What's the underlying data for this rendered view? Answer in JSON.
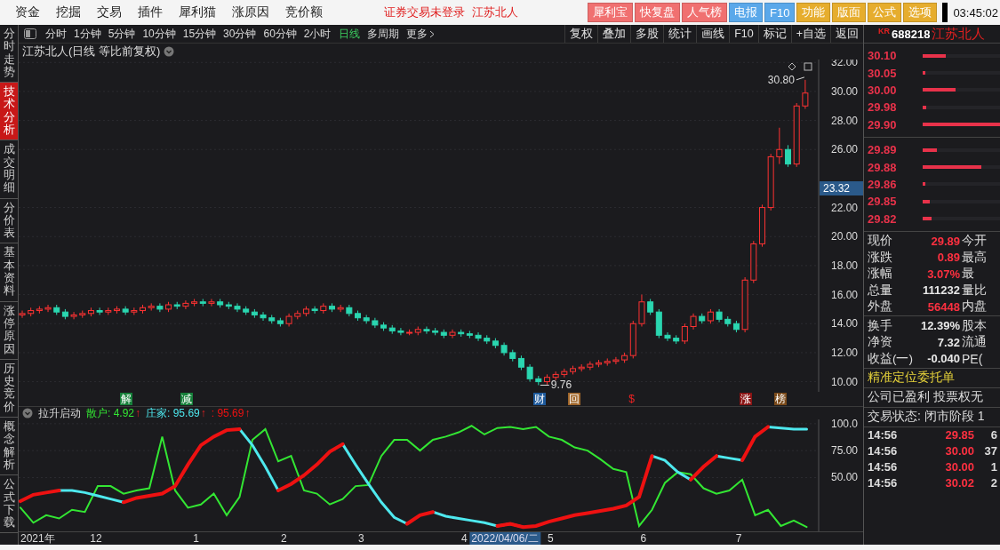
{
  "menu_bar": {
    "items": [
      "资金",
      "挖掘",
      "交易",
      "插件",
      "犀利猫",
      "涨原因",
      "竞价额"
    ],
    "login_status": "证券交易未登录",
    "stock_name": "江苏北人",
    "buttons": [
      {
        "label": "犀利宝",
        "color": "#f07070"
      },
      {
        "label": "快复盘",
        "color": "#f07070"
      },
      {
        "label": "人气榜",
        "color": "#f07070"
      },
      {
        "label": "电报",
        "color": "#5aa8ea"
      },
      {
        "label": "F10",
        "color": "#5aa8ea"
      },
      {
        "label": "功能",
        "color": "#e6ad2e"
      },
      {
        "label": "版面",
        "color": "#e6ad2e"
      },
      {
        "label": "公式",
        "color": "#e6ad2e"
      },
      {
        "label": "选项",
        "color": "#e6ad2e"
      }
    ],
    "clock": "03:45:02"
  },
  "side_tabs": [
    {
      "label": "分时走势",
      "selected": false
    },
    {
      "label": "技术分析",
      "selected": true
    },
    {
      "label": "成交明细",
      "selected": false
    },
    {
      "label": "分价表",
      "selected": false
    },
    {
      "label": "基本资料",
      "selected": false
    },
    {
      "label": "涨停原因",
      "selected": false
    },
    {
      "label": "历史竞价",
      "selected": false
    },
    {
      "label": "概念解析",
      "selected": false
    },
    {
      "label": "公式下载",
      "selected": false
    }
  ],
  "period_tabs": [
    {
      "label": "分时",
      "selected": false
    },
    {
      "label": "1分钟",
      "selected": false
    },
    {
      "label": "5分钟",
      "selected": false
    },
    {
      "label": "10分钟",
      "selected": false
    },
    {
      "label": "15分钟",
      "selected": false
    },
    {
      "label": "30分钟",
      "selected": false
    },
    {
      "label": "60分钟",
      "selected": false
    },
    {
      "label": "2小时",
      "selected": false
    },
    {
      "label": "日线",
      "selected": true
    },
    {
      "label": "多周期",
      "selected": false
    },
    {
      "label": "更多",
      "selected": false
    }
  ],
  "tools": [
    "复权",
    "叠加",
    "多股",
    "统计",
    "画线",
    "F10",
    "标记",
    "+自选",
    "返回"
  ],
  "price_chart": {
    "title": "江苏北人(日线 等比前复权)",
    "cursor_price": "23.32",
    "chart_data": {
      "type": "candlestick",
      "grid": true,
      "ylim": [
        9.3,
        32.2
      ],
      "yticks": [
        {
          "value": 10,
          "label": "10.00"
        },
        {
          "value": 12,
          "label": "12.00"
        },
        {
          "value": 14,
          "label": "14.00"
        },
        {
          "value": 16,
          "label": "16.00"
        },
        {
          "value": 18,
          "label": "18.00"
        },
        {
          "value": 20,
          "label": "20.00"
        },
        {
          "value": 22,
          "label": "22.00"
        },
        {
          "value": 26,
          "label": "26.00"
        },
        {
          "value": 28,
          "label": "28.00"
        },
        {
          "value": 30,
          "label": "30.00"
        },
        {
          "value": 32,
          "label": "32.00"
        }
      ],
      "ohlc": [
        [
          14.6,
          14.9,
          14.4,
          14.7
        ],
        [
          14.7,
          15.1,
          14.5,
          14.9
        ],
        [
          14.9,
          15.2,
          14.7,
          15.0
        ],
        [
          15.0,
          15.3,
          14.8,
          15.1
        ],
        [
          15.1,
          15.3,
          14.6,
          14.8
        ],
        [
          14.8,
          15.0,
          14.3,
          14.5
        ],
        [
          14.5,
          14.8,
          14.3,
          14.6
        ],
        [
          14.6,
          14.9,
          14.4,
          14.7
        ],
        [
          14.7,
          15.1,
          14.5,
          14.9
        ],
        [
          14.9,
          15.1,
          14.6,
          14.8
        ],
        [
          14.8,
          15.1,
          14.6,
          14.9
        ],
        [
          14.9,
          15.2,
          14.7,
          15.0
        ],
        [
          15.0,
          15.2,
          14.6,
          14.8
        ],
        [
          14.8,
          15.1,
          14.6,
          14.9
        ],
        [
          14.9,
          15.3,
          14.7,
          15.1
        ],
        [
          15.1,
          15.4,
          14.9,
          15.2
        ],
        [
          15.2,
          15.4,
          14.8,
          15.0
        ],
        [
          15.0,
          15.5,
          14.8,
          15.3
        ],
        [
          15.3,
          15.5,
          15.0,
          15.2
        ],
        [
          15.2,
          15.6,
          15.0,
          15.4
        ],
        [
          15.4,
          15.7,
          15.2,
          15.5
        ],
        [
          15.5,
          15.7,
          15.2,
          15.4
        ],
        [
          15.4,
          15.7,
          15.2,
          15.5
        ],
        [
          15.5,
          15.7,
          15.1,
          15.3
        ],
        [
          15.3,
          15.5,
          15.0,
          15.2
        ],
        [
          15.2,
          15.4,
          14.8,
          15.0
        ],
        [
          15.0,
          15.2,
          14.6,
          14.8
        ],
        [
          14.8,
          15.0,
          14.4,
          14.6
        ],
        [
          14.6,
          14.8,
          14.2,
          14.4
        ],
        [
          14.4,
          14.6,
          14.0,
          14.2
        ],
        [
          14.2,
          14.4,
          13.8,
          14.0
        ],
        [
          14.0,
          14.7,
          13.8,
          14.5
        ],
        [
          14.5,
          14.9,
          14.3,
          14.7
        ],
        [
          14.7,
          15.2,
          14.5,
          15.0
        ],
        [
          15.0,
          15.2,
          14.7,
          14.9
        ],
        [
          14.9,
          15.4,
          14.7,
          15.2
        ],
        [
          15.2,
          15.4,
          14.8,
          15.0
        ],
        [
          15.0,
          15.3,
          14.8,
          15.1
        ],
        [
          15.1,
          15.3,
          14.5,
          14.7
        ],
        [
          14.7,
          14.9,
          14.2,
          14.4
        ],
        [
          14.4,
          14.6,
          14.0,
          14.2
        ],
        [
          14.2,
          14.4,
          13.7,
          13.9
        ],
        [
          13.9,
          14.1,
          13.5,
          13.7
        ],
        [
          13.7,
          13.9,
          13.3,
          13.5
        ],
        [
          13.5,
          13.7,
          13.2,
          13.4
        ],
        [
          13.4,
          13.6,
          13.2,
          13.4
        ],
        [
          13.4,
          13.8,
          13.2,
          13.6
        ],
        [
          13.6,
          13.8,
          13.3,
          13.5
        ],
        [
          13.5,
          13.7,
          13.2,
          13.4
        ],
        [
          13.4,
          13.6,
          13.0,
          13.2
        ],
        [
          13.2,
          13.6,
          13.0,
          13.4
        ],
        [
          13.4,
          13.6,
          13.1,
          13.3
        ],
        [
          13.3,
          13.5,
          13.0,
          13.2
        ],
        [
          13.2,
          13.4,
          12.8,
          13.0
        ],
        [
          13.0,
          13.2,
          12.6,
          12.8
        ],
        [
          12.8,
          13.0,
          12.3,
          12.5
        ],
        [
          12.5,
          12.7,
          11.8,
          12.0
        ],
        [
          12.0,
          12.2,
          11.4,
          11.6
        ],
        [
          11.6,
          11.8,
          10.8,
          11.0
        ],
        [
          11.0,
          11.2,
          10.0,
          10.2
        ],
        [
          10.2,
          10.4,
          9.76,
          10.0
        ],
        [
          10.0,
          10.5,
          9.8,
          10.3
        ],
        [
          10.3,
          10.7,
          10.1,
          10.5
        ],
        [
          10.5,
          10.9,
          10.3,
          10.7
        ],
        [
          10.7,
          11.1,
          10.5,
          10.9
        ],
        [
          10.9,
          11.2,
          10.7,
          11.0
        ],
        [
          11.0,
          11.4,
          10.8,
          11.2
        ],
        [
          11.2,
          11.5,
          11.0,
          11.3
        ],
        [
          11.3,
          11.6,
          11.1,
          11.4
        ],
        [
          11.4,
          11.7,
          11.2,
          11.5
        ],
        [
          11.5,
          12.0,
          11.3,
          11.8
        ],
        [
          11.8,
          14.2,
          11.6,
          14.0
        ],
        [
          14.0,
          16.0,
          13.8,
          15.5
        ],
        [
          15.5,
          15.7,
          14.6,
          14.8
        ],
        [
          14.8,
          15.0,
          13.0,
          13.2
        ],
        [
          13.2,
          13.4,
          12.8,
          13.0
        ],
        [
          13.0,
          13.2,
          12.6,
          12.8
        ],
        [
          12.8,
          14.0,
          12.6,
          13.8
        ],
        [
          13.8,
          14.7,
          13.6,
          14.5
        ],
        [
          14.5,
          14.7,
          14.0,
          14.2
        ],
        [
          14.2,
          15.0,
          14.0,
          14.8
        ],
        [
          14.8,
          15.0,
          14.1,
          14.3
        ],
        [
          14.3,
          14.5,
          13.8,
          14.0
        ],
        [
          14.0,
          14.2,
          13.4,
          13.6
        ],
        [
          13.6,
          17.2,
          13.4,
          17.0
        ],
        [
          17.0,
          19.7,
          16.8,
          19.5
        ],
        [
          19.5,
          22.2,
          19.3,
          22.0
        ],
        [
          22.0,
          25.7,
          21.8,
          25.5
        ],
        [
          25.5,
          27.5,
          25.0,
          26.0
        ],
        [
          26.0,
          26.3,
          24.8,
          25.0
        ],
        [
          25.0,
          29.2,
          24.8,
          29.0
        ],
        [
          29.0,
          30.8,
          28.8,
          29.89
        ]
      ],
      "annotations": [
        "30.80",
        "9.76"
      ]
    }
  },
  "event_markers": [
    {
      "label": "解",
      "color": "#16803a"
    },
    {
      "label": "减",
      "color": "#16803a"
    },
    {
      "label": "财",
      "color": "#1e5a9c"
    },
    {
      "label": "回",
      "color": "#a0662a"
    },
    {
      "label": "$",
      "color": "#1c1c20"
    },
    {
      "label": "涨",
      "color": "#8a1414"
    },
    {
      "label": "榜",
      "color": "#7a4a1a"
    }
  ],
  "indicator": {
    "name": "拉升启动",
    "legend": [
      {
        "text": "散户: 4.92",
        "arrow": "↑",
        "color": "#33e633"
      },
      {
        "text": "庄家: 95.69",
        "arrow": "↑",
        "color": "#4ee8ee"
      },
      {
        "text": ": 95.69",
        "arrow": "↑",
        "color": "#ee1111"
      }
    ],
    "chart_data": {
      "type": "line",
      "grid": true,
      "ylim": [
        0,
        104
      ],
      "yticks": [
        {
          "value": 50,
          "label": "50.00"
        },
        {
          "value": 75,
          "label": "75.00"
        },
        {
          "value": 100,
          "label": "100.0"
        }
      ],
      "series": [
        {
          "color": "#33e633",
          "values": [
            22,
            8,
            15,
            12,
            20,
            18,
            42,
            42,
            35,
            38,
            40,
            88,
            38,
            22,
            25,
            35,
            15,
            32,
            85,
            95,
            65,
            70,
            38,
            35,
            25,
            30,
            42,
            43,
            70,
            85,
            85,
            75,
            85,
            88,
            92,
            98,
            90,
            96,
            97,
            95,
            97,
            88,
            85,
            78,
            75,
            67,
            58,
            55,
            5,
            20,
            45,
            55,
            53,
            40,
            35,
            38,
            48,
            15,
            20,
            5,
            10,
            4
          ]
        },
        {
          "color": "#4ee8ee",
          "values": [
            null,
            null,
            null,
            38,
            38,
            36,
            33,
            30,
            27,
            null,
            null,
            null,
            null,
            null,
            null,
            null,
            null,
            95,
            80,
            60,
            38,
            null,
            null,
            null,
            null,
            81,
            62,
            44,
            27,
            13,
            7,
            null,
            18,
            14,
            12,
            10,
            8,
            5,
            7,
            4,
            null,
            null,
            null,
            null,
            null,
            null,
            null,
            null,
            null,
            70,
            66,
            55,
            48,
            null,
            70,
            68,
            66,
            null,
            97,
            96,
            95,
            95
          ]
        },
        {
          "color": "#ee1111",
          "values": [
            28,
            34,
            36,
            38,
            null,
            null,
            null,
            null,
            27,
            31,
            33,
            35,
            42,
            62,
            80,
            88,
            94,
            95,
            null,
            null,
            38,
            44,
            52,
            62,
            74,
            81,
            null,
            null,
            null,
            null,
            7,
            15,
            18,
            null,
            null,
            null,
            null,
            5,
            7,
            4,
            5,
            9,
            12,
            15,
            17,
            19,
            21,
            24,
            32,
            70,
            null,
            null,
            48,
            60,
            70,
            null,
            66,
            88,
            97,
            null,
            null,
            null
          ]
        }
      ]
    }
  },
  "x_axis": {
    "labels": [
      "2021年",
      "12",
      "1",
      "2",
      "3",
      "4",
      "5",
      "6",
      "7"
    ],
    "cursor": "2022/04/06/二"
  },
  "quote_panel": {
    "code_prefix": "KR",
    "code": "688218",
    "name": "江苏北人",
    "asks": [
      {
        "price": "30.10",
        "level": 0.3
      },
      {
        "price": "30.05",
        "level": 0.04
      },
      {
        "price": "30.00",
        "level": 0.42
      },
      {
        "price": "29.98",
        "level": 0.05
      },
      {
        "price": "29.90",
        "level": 1
      }
    ],
    "bids": [
      {
        "price": "29.89",
        "level": 0.18
      },
      {
        "price": "29.88",
        "level": 0.76
      },
      {
        "price": "29.86",
        "level": 0.04
      },
      {
        "price": "29.85",
        "level": 0.09
      },
      {
        "price": "29.82",
        "level": 0.11
      }
    ],
    "stats": [
      {
        "label": "现价",
        "value": "29.89",
        "rise": true,
        "label_2": "今开"
      },
      {
        "label": "涨跌",
        "value": "0.89",
        "rise": true,
        "label_2": "最高"
      },
      {
        "label": "涨幅",
        "value": "3.07%",
        "rise": true,
        "label_2": "最"
      },
      {
        "label": "总量",
        "value": "111232",
        "rise": false,
        "label_2": "量比"
      },
      {
        "label": "外盘",
        "value": "56448",
        "rise": true,
        "label_2": "内盘"
      }
    ],
    "stats_2": [
      {
        "label": "换手",
        "value": "12.39%",
        "rise": false,
        "label_2": "股本"
      },
      {
        "label": "净资",
        "value": "7.32",
        "rise": false,
        "label_2": "流通"
      },
      {
        "label": "收益(一)",
        "value": "-0.040",
        "rise": false,
        "label_2": "PE("
      }
    ],
    "notice": "精准定位委托单",
    "info": [
      "公司已盈利 投票权无",
      "交易状态: 闭市阶段 1"
    ],
    "trades": [
      {
        "time": "14:56",
        "price": "29.85",
        "volume": "6"
      },
      {
        "time": "14:56",
        "price": "30.00",
        "volume": "37"
      },
      {
        "time": "14:56",
        "price": "30.00",
        "volume": "1"
      },
      {
        "time": "14:56",
        "price": "30.02",
        "volume": "2"
      }
    ]
  }
}
